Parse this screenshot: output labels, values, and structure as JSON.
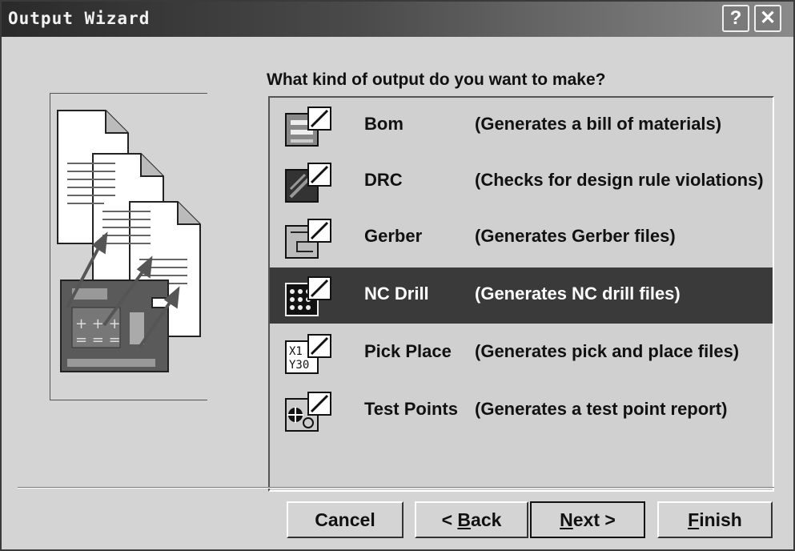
{
  "window": {
    "title": "Output Wizard",
    "help_glyph": "?",
    "close_glyph": "✕"
  },
  "prompt": "What kind of output do you want to make?",
  "outputs": [
    {
      "name": "Bom",
      "description": "(Generates a bill of materials)",
      "icon": "bom-icon",
      "selected": false
    },
    {
      "name": "DRC",
      "description": "(Checks for design rule violations)",
      "icon": "drc-icon",
      "selected": false
    },
    {
      "name": "Gerber",
      "description": "(Generates Gerber files)",
      "icon": "gerber-icon",
      "selected": false
    },
    {
      "name": "NC Drill",
      "description": "(Generates NC drill files)",
      "icon": "nc-drill-icon",
      "selected": true
    },
    {
      "name": "Pick Place",
      "description": "(Generates pick and place files)",
      "icon": "pick-place-icon",
      "selected": false
    },
    {
      "name": "Test Points",
      "description": "(Generates a test point report)",
      "icon": "test-points-icon",
      "selected": false
    }
  ],
  "buttons": {
    "cancel": "Cancel",
    "back": {
      "pre": "< ",
      "key": "B",
      "post": "ack"
    },
    "next": {
      "key": "N",
      "post": "ext >"
    },
    "finish": {
      "key": "F",
      "post": "inish"
    }
  },
  "colors": {
    "selection": "#3a3a3a",
    "face": "#d4d4d4"
  }
}
